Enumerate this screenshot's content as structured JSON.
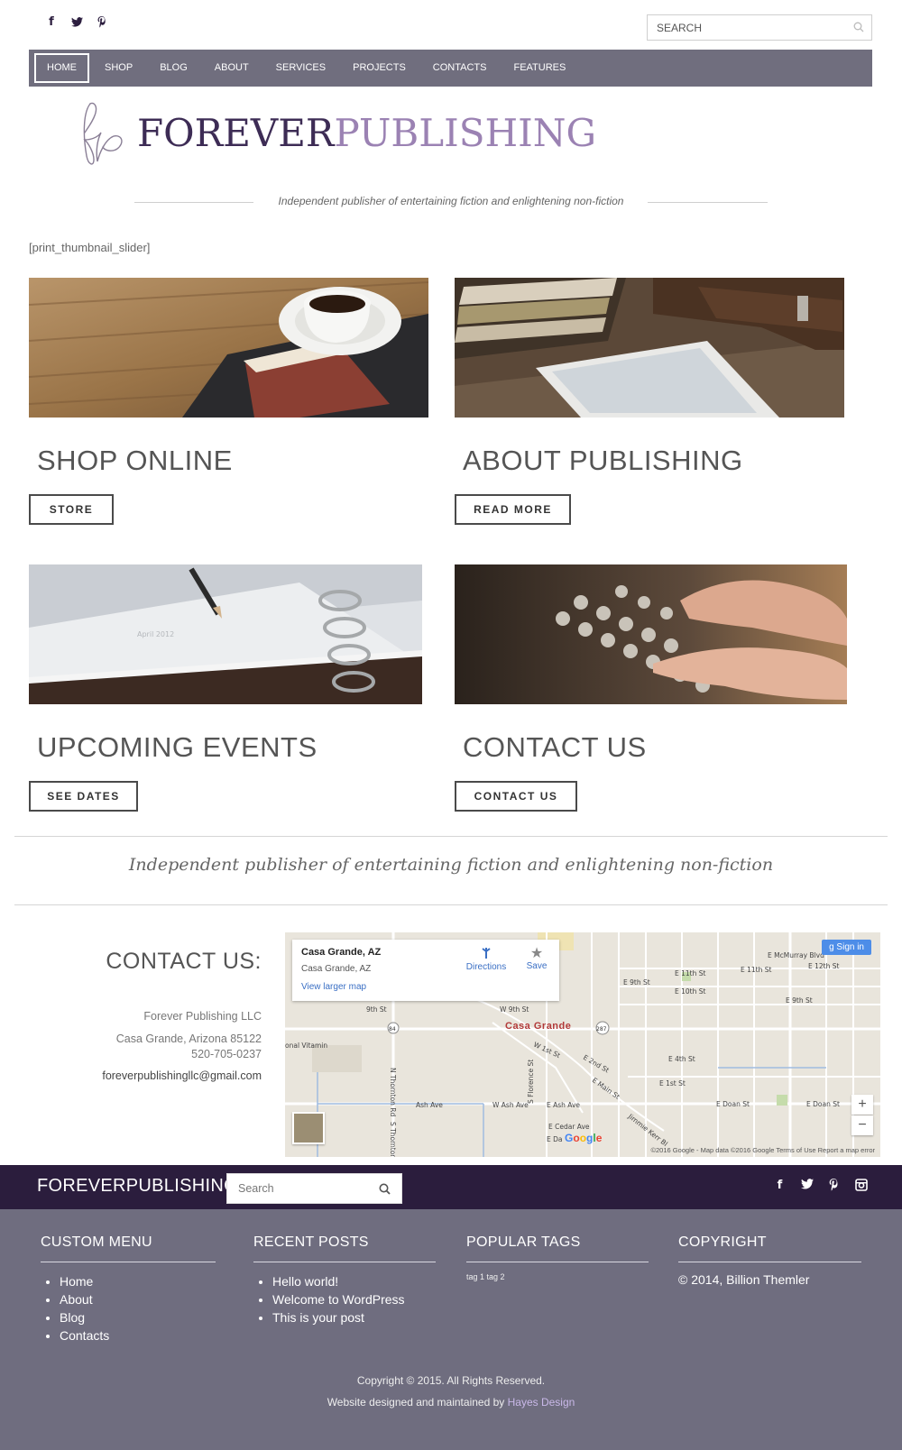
{
  "social_top": [
    "facebook-icon",
    "twitter-icon",
    "pinterest-icon"
  ],
  "search_top": {
    "placeholder": "SEARCH"
  },
  "nav": [
    {
      "label": "HOME",
      "active": true
    },
    {
      "label": "SHOP"
    },
    {
      "label": "BLOG"
    },
    {
      "label": "ABOUT"
    },
    {
      "label": "SERVICES"
    },
    {
      "label": "PROJECTS"
    },
    {
      "label": "CONTACTS"
    },
    {
      "label": "FEATURES"
    }
  ],
  "logo": {
    "part1": "FOREVER",
    "part2": "PUBLISHING"
  },
  "tagline": "Independent publisher of entertaining fiction and enlightening non-fiction",
  "shortcode": "[print_thumbnail_slider]",
  "features": [
    {
      "title": "SHOP ONLINE",
      "button": "STORE"
    },
    {
      "title": "ABOUT PUBLISHING",
      "button": "READ MORE"
    },
    {
      "title": "UPCOMING EVENTS",
      "button": "SEE DATES"
    },
    {
      "title": "CONTACT US",
      "button": "CONTACT US"
    }
  ],
  "quote": "Independent publisher of entertaining fiction and enlightening non-fiction",
  "contact": {
    "title": "CONTACT US:",
    "company": "Forever Publishing LLC",
    "address": "Casa Grande, Arizona 85122",
    "phone": "520-705-0237",
    "email": "foreverpublishingllc@gmail.com"
  },
  "map": {
    "place": "Casa Grande, AZ",
    "address": "Casa Grande, AZ",
    "larger_link": "View larger map",
    "directions": "Directions",
    "save": "Save",
    "signin": "Sign in",
    "city_label": "Casa Grande",
    "footer": "©2016 Google - Map data ©2016 Google    Terms of Use    Report a map error",
    "google": "Google",
    "streets": [
      "W 9th St",
      "9th St",
      "W 1st St",
      "E 2nd St",
      "E Main St",
      "Ash Ave",
      "W Ash Ave",
      "E Ash Ave",
      "E Cedar Ave",
      "E 4th St",
      "E 1st St",
      "E Doan St",
      "E 9th St",
      "E 11th St",
      "E 10th St",
      "E 12th St",
      "E McMurray Blvd",
      "onal Vitamin",
      "N Thornton Rd",
      "S Thornton Rd",
      "S Florence St",
      "Jimmie Kerr Blvd",
      "84",
      "287"
    ]
  },
  "footer": {
    "brand": "FOREVERPUBLISHING",
    "search_placeholder": "Search",
    "social": [
      "facebook-icon",
      "twitter-icon",
      "pinterest-icon",
      "instagram-icon"
    ]
  },
  "widgets": {
    "custom_menu": {
      "title": "CUSTOM MENU",
      "items": [
        "Home",
        "About",
        "Blog",
        "Contacts"
      ]
    },
    "recent_posts": {
      "title": "RECENT POSTS",
      "items": [
        "Hello world!",
        "Welcome to WordPress",
        "This is your post"
      ]
    },
    "popular_tags": {
      "title": "POPULAR TAGS",
      "tags": "tag 1  tag 2"
    },
    "copyright": {
      "title": "COPYRIGHT",
      "text": "© 2014, Billion Themler"
    }
  },
  "bottom": {
    "copyright": "Copyright © 2015.  All Rights Reserved.",
    "designed_by": "Website designed and maintained by ",
    "designer": "Hayes Design"
  }
}
